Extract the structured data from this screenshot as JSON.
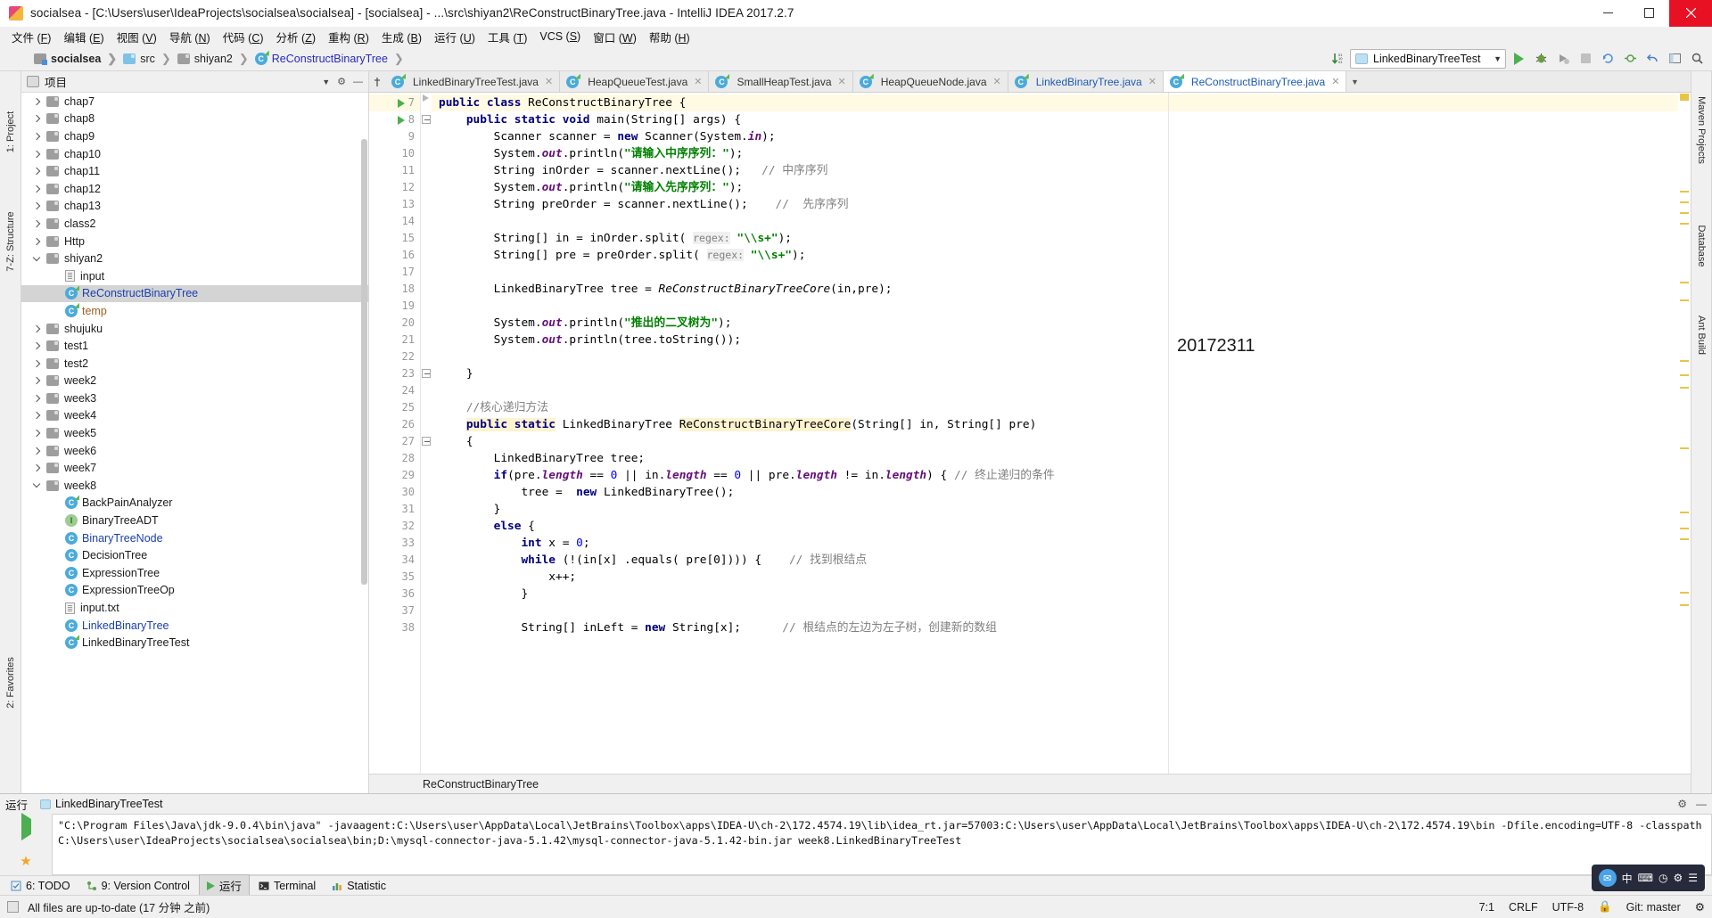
{
  "window": {
    "title": "socialsea - [C:\\Users\\user\\IdeaProjects\\socialsea\\socialsea] - [socialsea] - ...\\src\\shiyan2\\ReConstructBinaryTree.java - IntelliJ IDEA 2017.2.7",
    "minimize": "minimize-icon",
    "maximize": "maximize-icon",
    "close": "close-icon"
  },
  "menubar": [
    {
      "label": "文件",
      "mnemonic": "F"
    },
    {
      "label": "编辑",
      "mnemonic": "E"
    },
    {
      "label": "视图",
      "mnemonic": "V"
    },
    {
      "label": "导航",
      "mnemonic": "N"
    },
    {
      "label": "代码",
      "mnemonic": "C"
    },
    {
      "label": "分析",
      "mnemonic": "Z"
    },
    {
      "label": "重构",
      "mnemonic": "R"
    },
    {
      "label": "生成",
      "mnemonic": "B"
    },
    {
      "label": "运行",
      "mnemonic": "U"
    },
    {
      "label": "工具",
      "mnemonic": "T"
    },
    {
      "label": "VCS",
      "mnemonic": "S"
    },
    {
      "label": "窗口",
      "mnemonic": "W"
    },
    {
      "label": "帮助",
      "mnemonic": "H"
    }
  ],
  "breadcrumb": [
    {
      "label": "socialsea",
      "icon": "project-icon"
    },
    {
      "label": "src",
      "icon": "folder-icon-blue"
    },
    {
      "label": "shiyan2",
      "icon": "folder-icon"
    },
    {
      "label": "ReConstructBinaryTree",
      "icon": "class-icon"
    }
  ],
  "toolbar": {
    "run_config": "LinkedBinaryTreeTest",
    "run_button": "run-icon",
    "debug_button": "debug-icon",
    "coverage_button": "coverage-icon",
    "stop_button": "stop-icon",
    "sort_button": "sort-alpha-icon",
    "search_button": "search-icon",
    "settings_button": "gear-icon",
    "layout_button": "layout-icon"
  },
  "project_panel": {
    "title": "项目",
    "icon": "project-panel-icon",
    "tree": [
      {
        "label": "chap7",
        "indent": 2,
        "twisty": "right",
        "icon": "folder"
      },
      {
        "label": "chap8",
        "indent": 2,
        "twisty": "right",
        "icon": "folder"
      },
      {
        "label": "chap9",
        "indent": 2,
        "twisty": "right",
        "icon": "folder"
      },
      {
        "label": "chap10",
        "indent": 2,
        "twisty": "right",
        "icon": "folder"
      },
      {
        "label": "chap11",
        "indent": 2,
        "twisty": "right",
        "icon": "folder"
      },
      {
        "label": "chap12",
        "indent": 2,
        "twisty": "right",
        "icon": "folder"
      },
      {
        "label": "chap13",
        "indent": 2,
        "twisty": "right",
        "icon": "folder"
      },
      {
        "label": "class2",
        "indent": 2,
        "twisty": "right",
        "icon": "folder"
      },
      {
        "label": "Http",
        "indent": 2,
        "twisty": "right",
        "icon": "folder"
      },
      {
        "label": "shiyan2",
        "indent": 2,
        "twisty": "down",
        "icon": "folder"
      },
      {
        "label": "input",
        "indent": 3,
        "twisty": "none",
        "icon": "file"
      },
      {
        "label": "ReConstructBinaryTree",
        "indent": 3,
        "twisty": "none",
        "icon": "class-green",
        "selected": true,
        "color": "#1a3fb0"
      },
      {
        "label": "temp",
        "indent": 3,
        "twisty": "none",
        "icon": "class-green",
        "color": "#a06020"
      },
      {
        "label": "shujuku",
        "indent": 2,
        "twisty": "right",
        "icon": "folder"
      },
      {
        "label": "test1",
        "indent": 2,
        "twisty": "right",
        "icon": "folder"
      },
      {
        "label": "test2",
        "indent": 2,
        "twisty": "right",
        "icon": "folder"
      },
      {
        "label": "week2",
        "indent": 2,
        "twisty": "right",
        "icon": "folder"
      },
      {
        "label": "week3",
        "indent": 2,
        "twisty": "right",
        "icon": "folder"
      },
      {
        "label": "week4",
        "indent": 2,
        "twisty": "right",
        "icon": "folder"
      },
      {
        "label": "week5",
        "indent": 2,
        "twisty": "right",
        "icon": "folder"
      },
      {
        "label": "week6",
        "indent": 2,
        "twisty": "right",
        "icon": "folder"
      },
      {
        "label": "week7",
        "indent": 2,
        "twisty": "right",
        "icon": "folder"
      },
      {
        "label": "week8",
        "indent": 2,
        "twisty": "down",
        "icon": "folder"
      },
      {
        "label": "BackPainAnalyzer",
        "indent": 3,
        "twisty": "none",
        "icon": "class-green"
      },
      {
        "label": "BinaryTreeADT",
        "indent": 3,
        "twisty": "none",
        "icon": "interface"
      },
      {
        "label": "BinaryTreeNode",
        "indent": 3,
        "twisty": "none",
        "icon": "class",
        "color": "#1a3fb0"
      },
      {
        "label": "DecisionTree",
        "indent": 3,
        "twisty": "none",
        "icon": "class"
      },
      {
        "label": "ExpressionTree",
        "indent": 3,
        "twisty": "none",
        "icon": "class"
      },
      {
        "label": "ExpressionTreeOp",
        "indent": 3,
        "twisty": "none",
        "icon": "class"
      },
      {
        "label": "input.txt",
        "indent": 3,
        "twisty": "none",
        "icon": "file"
      },
      {
        "label": "LinkedBinaryTree",
        "indent": 3,
        "twisty": "none",
        "icon": "class",
        "color": "#1a3fb0"
      },
      {
        "label": "LinkedBinaryTreeTest",
        "indent": 3,
        "twisty": "none",
        "icon": "class-green"
      }
    ]
  },
  "left_rail": [
    "1: Project",
    "7-Z: Structure",
    "2: Favorites"
  ],
  "right_rail": [
    "Maven Projects",
    "Database",
    "Ant Build"
  ],
  "editor_tabs": [
    {
      "label": "LinkedBinaryTreeTest.java",
      "active": false,
      "modified": false
    },
    {
      "label": "HeapQueueTest.java",
      "active": false,
      "modified": false
    },
    {
      "label": "SmallHeapTest.java",
      "active": false,
      "modified": false
    },
    {
      "label": "HeapQueueNode.java",
      "active": false,
      "modified": false
    },
    {
      "label": "LinkedBinaryTree.java",
      "active": false,
      "modified": true
    },
    {
      "label": "ReConstructBinaryTree.java",
      "active": true,
      "modified": true
    }
  ],
  "editor": {
    "note": "20172311",
    "breadcrumb_bottom": "ReConstructBinaryTree",
    "first_line_number": 7,
    "lines": [
      {
        "n": 7,
        "html": "<span class=\"kw\">public class</span> <span class=\"plain\">ReConstructBinaryTree {</span>",
        "indent": 0,
        "highlight": true
      },
      {
        "n": 8,
        "html": "    <span class=\"kw\">public static void</span> <span class=\"plain\">main(String[] args) {</span>"
      },
      {
        "n": 9,
        "html": "        <span class=\"plain\">Scanner scanner = </span><span class=\"kw\">new</span><span class=\"plain\"> Scanner(System.</span><span class=\"fld\">in</span><span class=\"plain\">);</span>"
      },
      {
        "n": 10,
        "html": "        <span class=\"plain\">System.</span><span class=\"fld\">out</span><span class=\"plain\">.println(</span><span class=\"str\">\"请输入中序序列：\"</span><span class=\"plain\">);</span>"
      },
      {
        "n": 11,
        "html": "        <span class=\"plain\">String inOrder = scanner.nextLine();</span>   <span class=\"cmt\">// 中序序列</span>"
      },
      {
        "n": 12,
        "html": "        <span class=\"plain\">System.</span><span class=\"fld\">out</span><span class=\"plain\">.println(</span><span class=\"str\">\"请输入先序序列：\"</span><span class=\"plain\">);</span>"
      },
      {
        "n": 13,
        "html": "        <span class=\"plain\">String preOrder = scanner.nextLine();</span>    <span class=\"cmt\">//  先序序列</span>"
      },
      {
        "n": 14,
        "html": ""
      },
      {
        "n": 15,
        "html": "        <span class=\"plain\">String[] in = inOrder.split(</span> <span class=\"hint\">regex:</span> <span class=\"str\">\"\\\\s+\"</span><span class=\"plain\">);</span>"
      },
      {
        "n": 16,
        "html": "        <span class=\"plain\">String[] pre = preOrder.split(</span> <span class=\"hint\">regex:</span> <span class=\"str\">\"\\\\s+\"</span><span class=\"plain\">);</span>"
      },
      {
        "n": 17,
        "html": ""
      },
      {
        "n": 18,
        "html": "        <span class=\"plain\">LinkedBinaryTree tree = </span><span class=\"ital\">ReConstructBinaryTreeCore</span><span class=\"plain\">(in,pre);</span>"
      },
      {
        "n": 19,
        "html": ""
      },
      {
        "n": 20,
        "html": "        <span class=\"plain\">System.</span><span class=\"fld\">out</span><span class=\"plain\">.println(</span><span class=\"str\">\"推出的二叉树为\"</span><span class=\"plain\">);</span>"
      },
      {
        "n": 21,
        "html": "        <span class=\"plain\">System.</span><span class=\"fld\">out</span><span class=\"plain\">.println(tree.toString());</span>"
      },
      {
        "n": 22,
        "html": ""
      },
      {
        "n": 23,
        "html": "    <span class=\"plain\">}</span>"
      },
      {
        "n": 24,
        "html": ""
      },
      {
        "n": 25,
        "html": "    <span class=\"cmt\">//核心递归方法</span>"
      },
      {
        "n": 26,
        "html": "    <span class=\"kw mhl\">public static</span><span class=\"plain\"> LinkedBinaryTree </span><span class=\"mhl\">ReConstructBinaryTreeCore</span><span class=\"plain\">(String[] in, String[] pre)</span>"
      },
      {
        "n": 27,
        "html": "    <span class=\"plain\">{</span>"
      },
      {
        "n": 28,
        "html": "        <span class=\"plain\">LinkedBinaryTree tree;</span>"
      },
      {
        "n": 29,
        "html": "        <span class=\"kw\">if</span><span class=\"plain\">(pre.</span><span class=\"fld\">length</span><span class=\"plain\"> == </span><span class=\"num\">0</span><span class=\"plain\"> || in.</span><span class=\"fld\">length</span><span class=\"plain\"> == </span><span class=\"num\">0</span><span class=\"plain\"> || pre.</span><span class=\"fld\">length</span><span class=\"plain\"> != in.</span><span class=\"fld\">length</span><span class=\"plain\">) {</span> <span class=\"cmt\">// 终止递归的条件</span>"
      },
      {
        "n": 30,
        "html": "            <span class=\"plain\">tree = </span> <span class=\"kw\">new</span><span class=\"plain\"> LinkedBinaryTree();</span>"
      },
      {
        "n": 31,
        "html": "        <span class=\"plain\">}</span>"
      },
      {
        "n": 32,
        "html": "        <span class=\"kw\">else</span><span class=\"plain\"> {</span>"
      },
      {
        "n": 33,
        "html": "            <span class=\"kw\">int</span><span class=\"plain\"> x = </span><span class=\"num\">0</span><span class=\"plain\">;</span>"
      },
      {
        "n": 34,
        "html": "            <span class=\"kw\">while</span><span class=\"plain\"> (!(in[x] .equals( pre[0]))) {</span>    <span class=\"cmt\">// 找到根结点</span>"
      },
      {
        "n": 35,
        "html": "                <span class=\"plain\">x++;</span>"
      },
      {
        "n": 36,
        "html": "            <span class=\"plain\">}</span>"
      },
      {
        "n": 37,
        "html": ""
      },
      {
        "n": 38,
        "html": "            <span class=\"plain\">String[] inLeft = </span><span class=\"kw\">new</span><span class=\"plain\"> String[x];</span>      <span class=\"cmt\">// 根结点的左边为左子树，创建新的数组</span>"
      }
    ]
  },
  "run_panel": {
    "title": "运行",
    "tab": "LinkedBinaryTreeTest",
    "console_text": "\"C:\\Program Files\\Java\\jdk-9.0.4\\bin\\java\" -javaagent:C:\\Users\\user\\AppData\\Local\\JetBrains\\Toolbox\\apps\\IDEA-U\\ch-2\\172.4574.19\\lib\\idea_rt.jar=57003:C:\\Users\\user\\AppData\\Local\\JetBrains\\Toolbox\\apps\\IDEA-U\\ch-2\\172.4574.19\\bin -Dfile.encoding=UTF-8 -classpath C:\\Users\\user\\IdeaProjects\\socialsea\\socialsea\\bin;D:\\mysql-connector-java-5.1.42\\mysql-connector-java-5.1.42-bin.jar week8.LinkedBinaryTreeTest",
    "rerun_icon": "run-icon",
    "stop_icon": "stop-icon",
    "settings_icon": "gear-icon",
    "minimize_icon": "minimize-icon"
  },
  "bottom_tabs": [
    {
      "label": "6: TODO",
      "icon": "todo-icon",
      "active": false
    },
    {
      "label": "9: Version Control",
      "icon": "vcs-icon",
      "active": false
    },
    {
      "label": "运行",
      "icon": "run-icon",
      "active": true
    },
    {
      "label": "Terminal",
      "icon": "terminal-icon",
      "active": false
    },
    {
      "label": "Statistic",
      "icon": "chart-icon",
      "active": false
    }
  ],
  "statusbar": {
    "message": "All files are up-to-date (17 分钟 之前)",
    "caret": "7:1",
    "line_sep": "CRLF",
    "encoding": "UTF-8",
    "branch": "Git: master",
    "lock_icon": "lock-icon",
    "event_icon": "event-log-icon"
  },
  "tray": {
    "items": [
      "message-icon",
      "ime-cn-label",
      "keyboard-icon",
      "clock-icon",
      "settings-icon",
      "menu-icon"
    ],
    "ime": "中"
  },
  "colors": {
    "accent": "#4a90d9",
    "run_green": "#4caf50",
    "close_red": "#e81123",
    "selection": "#d4d4d4",
    "highlight_line": "#fffae3",
    "match_highlight": "#fdf3cf"
  }
}
